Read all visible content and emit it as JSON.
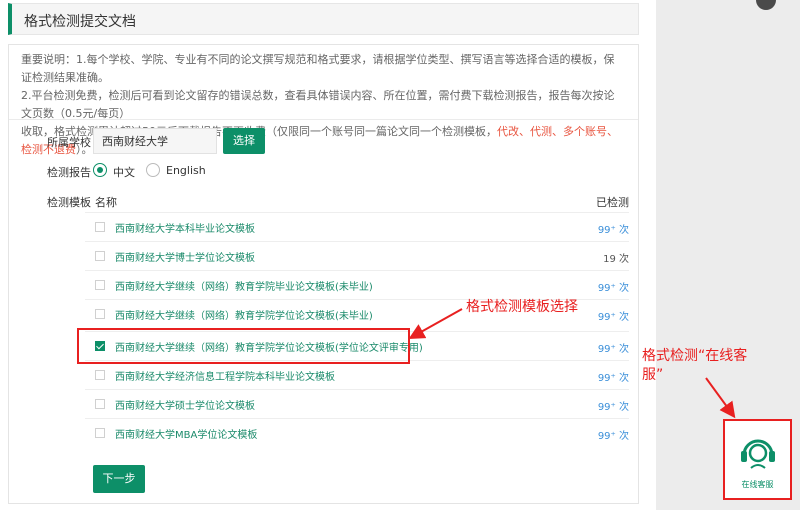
{
  "header": {
    "title": "格式检测提交文档"
  },
  "notice": {
    "line1": "重要说明：1.每个学校、学院、专业有不同的论文撰写规范和格式要求，请根据学位类型、撰写语言等选择合适的模板，保证检测结果准确。",
    "line2": "2.平台检测免费，检测后可看到论文留存的错误总数，查看具体错误内容、所在位置，需付费下载检测报告，报告每次按论文页数（0.5元/每页）",
    "line3_prefix": "收取，格式检测累计超过50元后下载报告不再收费（仅限同一个账号同一篇论文同一个检测模板，",
    "line3_red": "代改、代测、多个账号、检测不退费",
    "line3_suffix": "）。"
  },
  "form": {
    "school_label": "所属学校",
    "school_value": "西南财经大学",
    "choose_button": "选择",
    "report_label": "检测报告",
    "options": [
      {
        "label": "中文",
        "selected": true
      },
      {
        "label": "English",
        "selected": false
      }
    ],
    "template_label": "检测模板",
    "col_name": "名称",
    "col_count": "已检测"
  },
  "templates": [
    {
      "name": "西南财经大学本科毕业论文模板",
      "count": "99⁺ 次",
      "checked": false
    },
    {
      "name": "西南财经大学博士学位论文模板",
      "count": "19 次",
      "checked": false
    },
    {
      "name": "西南财经大学继续（网络）教育学院毕业论文模板(未毕业)",
      "count": "99⁺ 次",
      "checked": false
    },
    {
      "name": "西南财经大学继续（网络）教育学院学位论文模板(未毕业)",
      "count": "99⁺ 次",
      "checked": false
    },
    {
      "name": "西南财经大学继续（网络）教育学院学位论文模板(学位论文评审专用)",
      "count": "99⁺ 次",
      "checked": true
    },
    {
      "name": "西南财经大学经济信息工程学院本科毕业论文模板",
      "count": "99⁺ 次",
      "checked": false
    },
    {
      "name": "西南财经大学硕士学位论文模板",
      "count": "99⁺ 次",
      "checked": false
    },
    {
      "name": "西南财经大学MBA学位论文模板",
      "count": "99⁺ 次",
      "checked": false
    }
  ],
  "next_button": "下一步",
  "annotations": {
    "template_select": "格式检测模板选择",
    "service_line1": "格式检测“在线客",
    "service_line2": "服”"
  },
  "chat_widget": {
    "caption": "在线客服"
  },
  "colors": {
    "accent": "#0d8f68",
    "annotation": "#e82020",
    "link": "#1a8a6a",
    "count": "#3b8fd9"
  }
}
